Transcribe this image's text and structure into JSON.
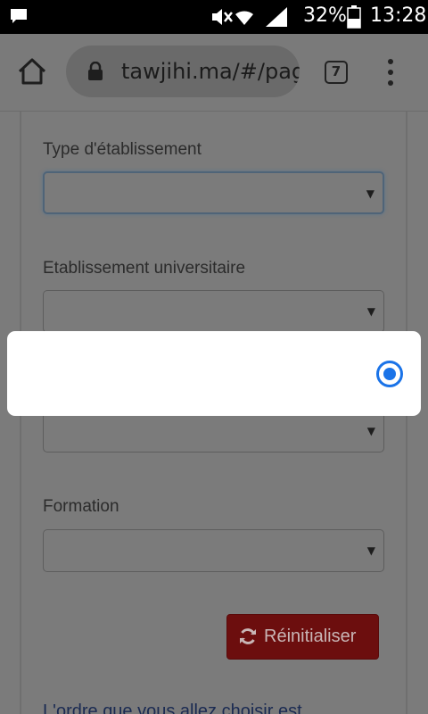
{
  "status_bar": {
    "battery_percent": "32%",
    "time": "13:28",
    "icons": [
      "notification-icon",
      "mute-icon",
      "wifi-icon",
      "signal-icon",
      "battery-icon"
    ]
  },
  "browser": {
    "url": "tawjihi.ma/#/page",
    "tab_count": "7",
    "icons": [
      "home-icon",
      "lock-icon",
      "tabs-icon",
      "menu-icon"
    ]
  },
  "form": {
    "fields": [
      {
        "label": "Type d'établissement",
        "value": ""
      },
      {
        "label": "Etablissement universitaire",
        "value": ""
      },
      {
        "label": "",
        "value": ""
      },
      {
        "label": "Formation",
        "value": ""
      }
    ],
    "reset_label": "Réinitialiser",
    "footer_text": "L'ordre que vous allez choisir est"
  },
  "dialog": {
    "option_label": "",
    "selected": true
  },
  "colors": {
    "accent": "#1a73e8",
    "reset_button": "#6c0e0e",
    "overlay": "#777777"
  }
}
